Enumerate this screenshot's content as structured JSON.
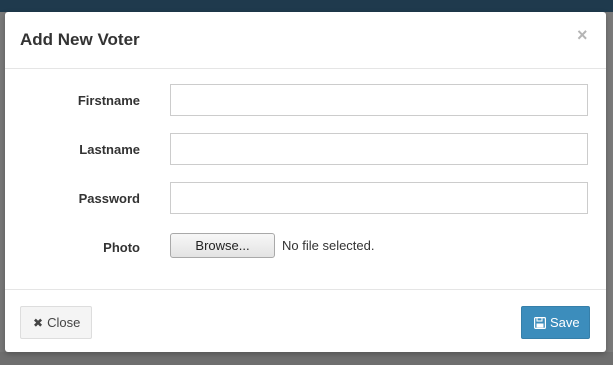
{
  "modal": {
    "title": "Add New Voter",
    "close_symbol": "×"
  },
  "form": {
    "firstname": {
      "label": "Firstname",
      "value": ""
    },
    "lastname": {
      "label": "Lastname",
      "value": ""
    },
    "password": {
      "label": "Password",
      "value": ""
    },
    "photo": {
      "label": "Photo",
      "button_label": "Browse...",
      "status": "No file selected."
    }
  },
  "footer": {
    "close_label": "Close",
    "close_icon": "times-icon",
    "save_label": "Save",
    "save_icon": "floppy-disk-icon"
  },
  "colors": {
    "primary": "#3c8dbc",
    "header_bar": "#1f3a4d"
  }
}
